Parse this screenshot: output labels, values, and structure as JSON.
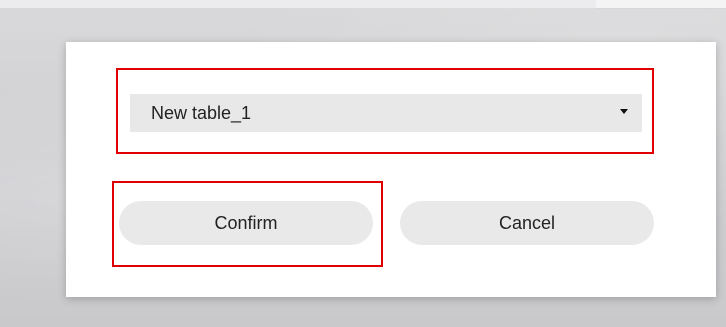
{
  "dialog": {
    "dropdown": {
      "selected_value": "New table_1",
      "icon": "chevron-down-icon"
    },
    "buttons": {
      "confirm_label": "Confirm",
      "cancel_label": "Cancel"
    }
  },
  "annotations": {
    "highlight_color": "#e00000"
  }
}
